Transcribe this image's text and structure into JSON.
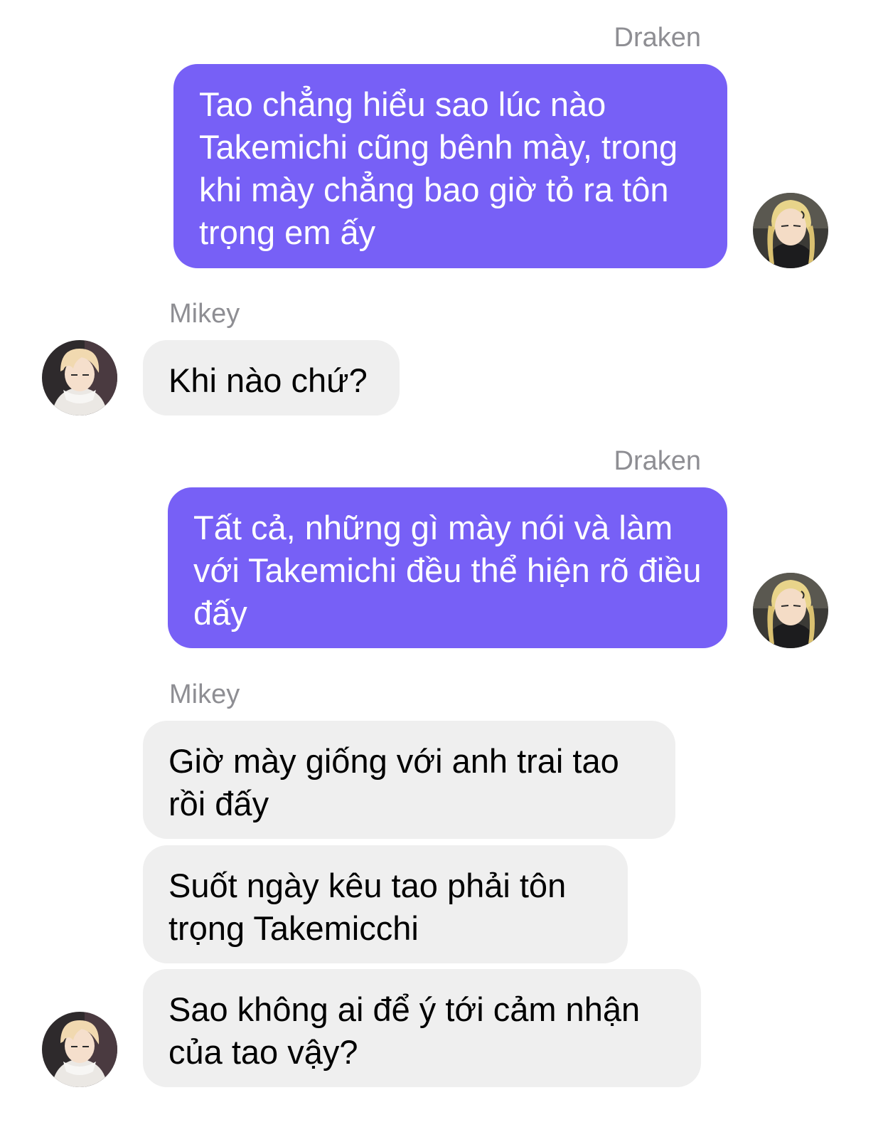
{
  "conversation": {
    "messages": [
      {
        "sender": "Draken",
        "direction": "outgoing",
        "text": "Tao chẳng hiểu sao lúc nào Takemichi cũng bênh mày, trong khi mày chẳng bao giờ tỏ ra tôn trọng em ấy"
      },
      {
        "sender": "Mikey",
        "direction": "incoming",
        "text": "Khi nào chứ?"
      },
      {
        "sender": "Draken",
        "direction": "outgoing",
        "text": "Tất cả, những gì mày nói và làm với Takemichi đều thể hiện rõ điều đấy"
      },
      {
        "sender": "Mikey",
        "direction": "incoming",
        "text": "Giờ mày giống với anh trai tao rồi đấy"
      },
      {
        "sender": "Mikey",
        "direction": "incoming",
        "text": "Suốt ngày kêu tao phải tôn trọng Takemicchi"
      },
      {
        "sender": "Mikey",
        "direction": "incoming",
        "text": "Sao không ai để ý tới cảm nhận của tao vậy?"
      }
    ],
    "avatars": {
      "draken": "draken-avatar-image",
      "mikey": "mikey-avatar-image"
    }
  },
  "colors": {
    "outgoing_bubble": "#7760f6",
    "incoming_bubble": "#efefef",
    "sender_name": "#8e8e93"
  }
}
